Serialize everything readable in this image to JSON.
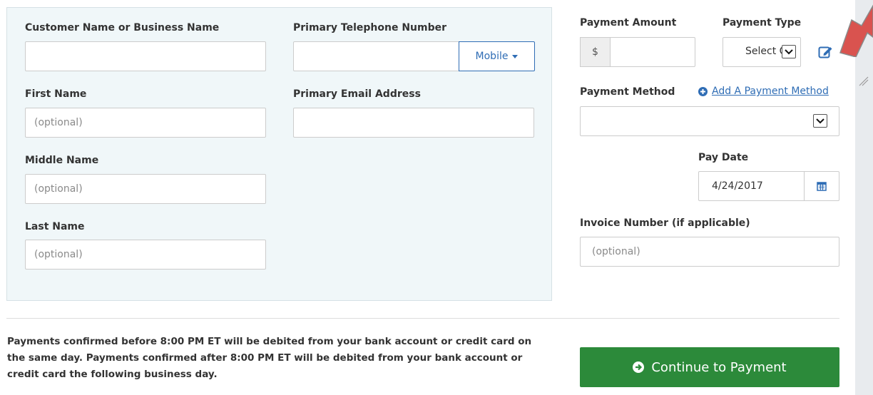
{
  "customer": {
    "name_label": "Customer Name or Business Name",
    "phone_label": "Primary Telephone Number",
    "phone_type": "Mobile",
    "first_name_label": "First Name",
    "email_label": "Primary Email Address",
    "middle_name_label": "Middle Name",
    "last_name_label": "Last Name",
    "optional_placeholder": "(optional)"
  },
  "payment": {
    "amount_label": "Payment Amount",
    "currency_symbol": "$",
    "type_label": "Payment Type",
    "type_selected": "Select O",
    "method_label": "Payment Method",
    "add_method_link": "Add A Payment Method",
    "pay_date_label": "Pay Date",
    "pay_date_value": "4/24/2017",
    "invoice_label": "Invoice Number (if applicable)",
    "invoice_placeholder": "(optional)"
  },
  "notice": "Payments confirmed before 8:00 PM ET will be debited from your bank account or credit card on the same day. Payments confirmed after 8:00 PM ET will be debited from your bank account or credit card the following business day.",
  "continue_label": "Continue to Payment",
  "colors": {
    "panel_bg": "#f0f7f9",
    "link_blue": "#2f6db5",
    "continue_green": "#2c8a3a",
    "annotation_arrow": "#d9534f"
  },
  "icons": [
    "chevron-down-icon",
    "edit-icon",
    "plus-circle-icon",
    "calendar-icon",
    "arrow-circle-right-icon"
  ]
}
